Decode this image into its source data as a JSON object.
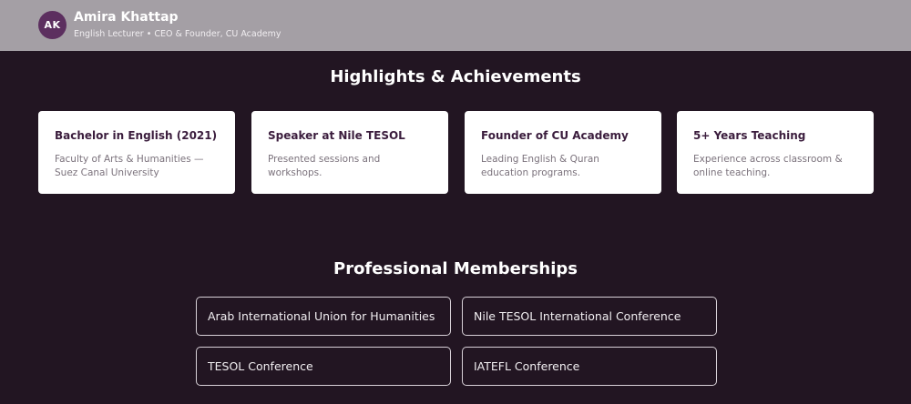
{
  "profile": {
    "initials": "AK",
    "name": "Amira Khattap",
    "subtitle": "English Lecturer • CEO & Founder, CU Academy"
  },
  "highlights": {
    "title": "Highlights & Achievements",
    "cards": [
      {
        "title": "Bachelor in English (2021)",
        "desc": "Faculty of Arts & Humanities — Suez Canal University"
      },
      {
        "title": "Speaker at Nile TESOL",
        "desc": "Presented sessions and workshops."
      },
      {
        "title": "Founder of CU Academy",
        "desc": "Leading English & Quran education programs."
      },
      {
        "title": "5+ Years Teaching",
        "desc": "Experience across classroom & online teaching."
      }
    ]
  },
  "memberships": {
    "title": "Professional Memberships",
    "items": [
      "Arab International Union for Humanities",
      "Nile TESOL International Conference",
      "TESOL Conference",
      "IATEFL Conference"
    ]
  },
  "colors": {
    "background": "#221522",
    "topbar": "#a49fa5",
    "avatar": "#5c2f5f",
    "card_title": "#3b1d3d"
  }
}
